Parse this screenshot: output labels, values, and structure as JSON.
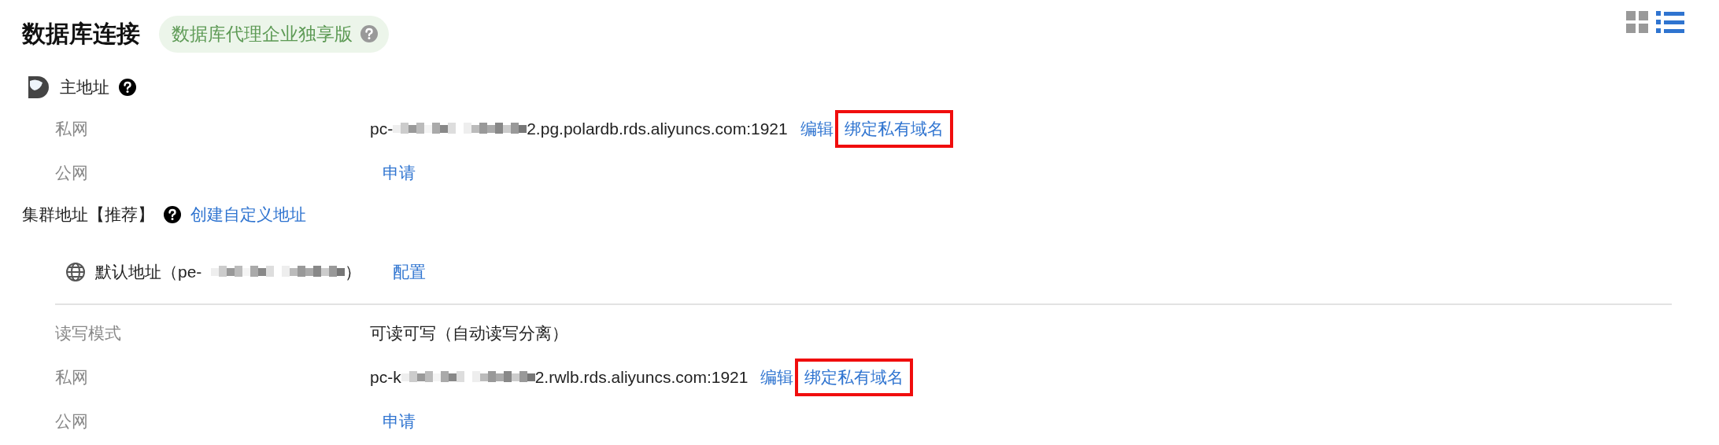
{
  "title": "数据库连接",
  "badge": {
    "label": "数据库代理企业独享版"
  },
  "view_toggle": [
    {
      "kind": "grid",
      "selected": false
    },
    {
      "kind": "list",
      "selected": true
    }
  ],
  "primary": {
    "title": "主地址",
    "rows": [
      {
        "label": "私网",
        "prefix": "pc-",
        "redacted": true,
        "suffix": "2.pg.polardb.rds.aliyuncs.com:1921",
        "links": [
          {
            "label": "编辑",
            "highlighted": false
          },
          {
            "label": "绑定私有域名",
            "highlighted": true
          }
        ]
      },
      {
        "label": "公网",
        "links": [
          {
            "label": "申请",
            "highlighted": false
          }
        ]
      }
    ]
  },
  "cluster": {
    "title": "集群地址【推荐】",
    "action": "创建自定义地址",
    "default": {
      "title_prefix": "默认地址（pe-",
      "title_suffix": "）",
      "action": "配置",
      "rows": [
        {
          "label": "读写模式",
          "text": "可读可写（自动读写分离）"
        },
        {
          "label": "私网",
          "prefix": "pc-k",
          "redacted": true,
          "suffix": "2.rwlb.rds.aliyuncs.com:1921",
          "links": [
            {
              "label": "编辑",
              "highlighted": false
            },
            {
              "label": "绑定私有域名",
              "highlighted": true
            }
          ]
        },
        {
          "label": "公网",
          "links": [
            {
              "label": "申请",
              "highlighted": false
            }
          ]
        }
      ]
    }
  }
}
